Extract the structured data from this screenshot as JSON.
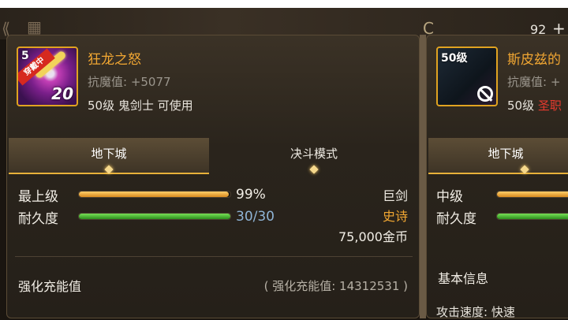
{
  "header": {
    "coin_icon": "coin-icon",
    "count": "92"
  },
  "left_item": {
    "level": "5",
    "ribbon": "穿戴中",
    "plus": "20",
    "name": "狂龙之怒",
    "stat": "抗魔值: +5077",
    "info": "50级 鬼剑士 可使用",
    "tabs": [
      {
        "label": "地下城",
        "active": true
      },
      {
        "label": "决斗模式",
        "active": false
      }
    ],
    "grade_label": "最上级",
    "grade_percent": 0.99,
    "grade_text": "99%",
    "durability_label": "耐久度",
    "durability_text": "30/30",
    "durability_fraction": 1.0,
    "type": "巨剑",
    "rarity": "史诗",
    "price": "75,000金币",
    "section_title": "强化充能值",
    "section_value": "( 强化充能值: 14312531 )"
  },
  "right_item": {
    "level": "50级",
    "name": "斯皮兹的",
    "stat": "抗魔值: +",
    "info_prefix": "50级",
    "info_red": "圣职",
    "tab": "地下城",
    "grade_label": "中级",
    "durability_label": "耐久度",
    "section_title": "基本信息",
    "attack_speed": "攻击速度: 快速"
  }
}
